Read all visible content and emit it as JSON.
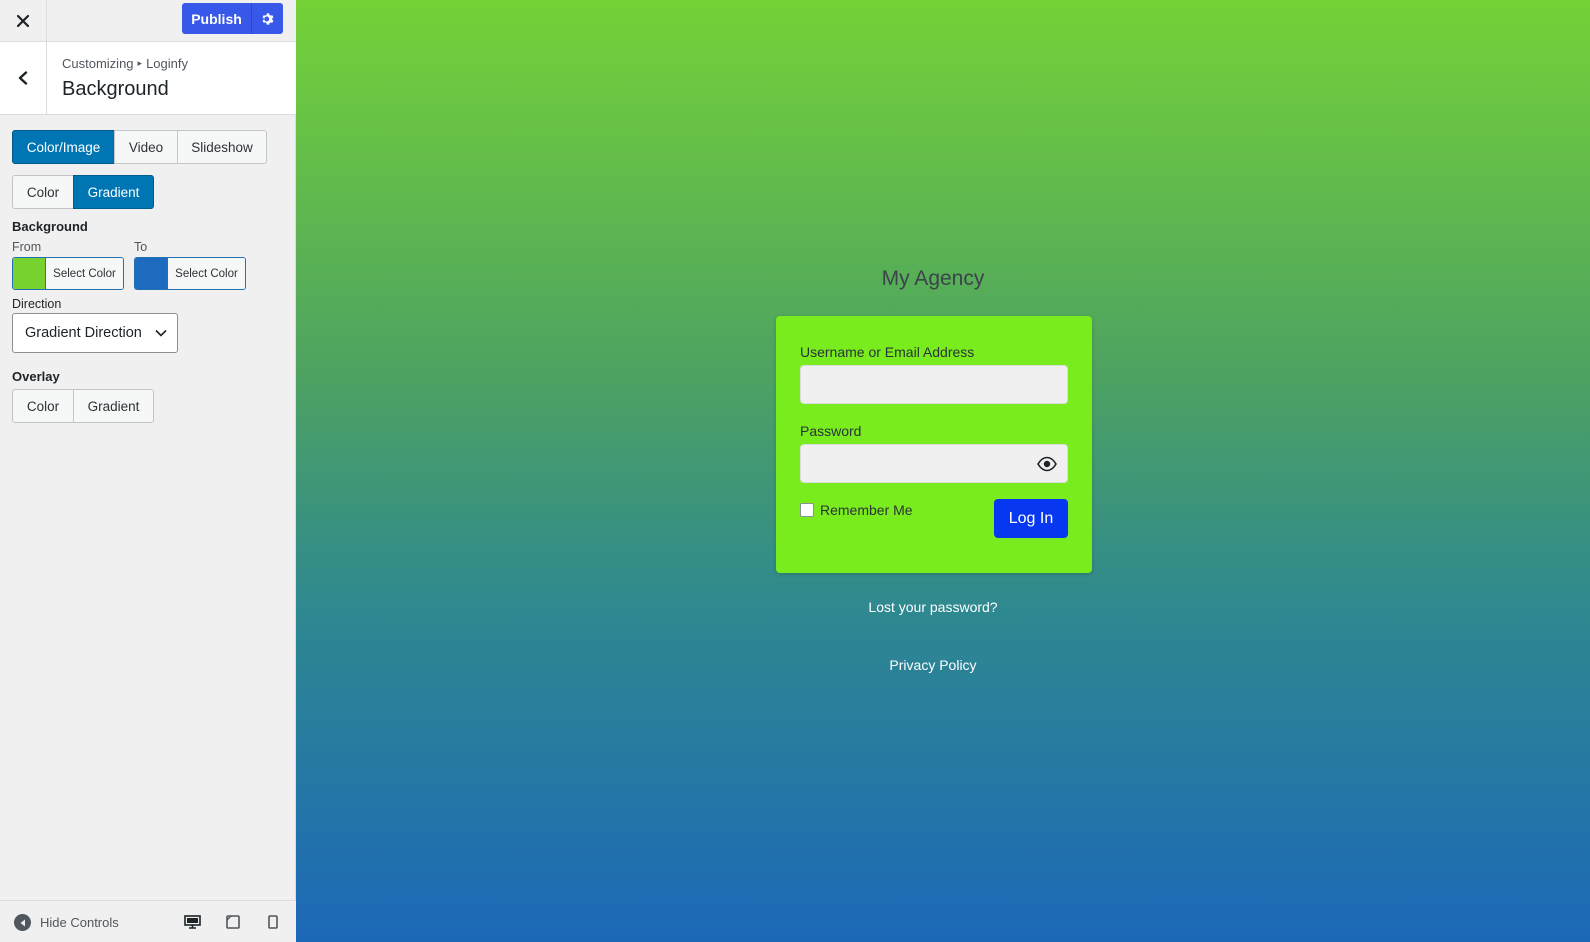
{
  "topbar": {
    "publish_label": "Publish"
  },
  "section": {
    "breadcrumb_parent": "Customizing",
    "breadcrumb_separator": "▸",
    "breadcrumb_child": "Loginfy",
    "title": "Background"
  },
  "bg_type_tabs": [
    {
      "label": "Color/Image",
      "active": true
    },
    {
      "label": "Video",
      "active": false
    },
    {
      "label": "Slideshow",
      "active": false
    }
  ],
  "bg_mode_tabs": [
    {
      "label": "Color",
      "active": false
    },
    {
      "label": "Gradient",
      "active": true
    }
  ],
  "background": {
    "heading": "Background",
    "from_label": "From",
    "to_label": "To",
    "from_color": "#77d22f",
    "to_color": "#1d6bbf",
    "select_color_label": "Select Color"
  },
  "direction": {
    "heading": "Direction",
    "selected": "Gradient Direction"
  },
  "overlay": {
    "heading": "Overlay",
    "tabs": [
      {
        "label": "Color",
        "active": false
      },
      {
        "label": "Gradient",
        "active": false
      }
    ]
  },
  "footer": {
    "hide_controls_label": "Hide Controls"
  },
  "preview": {
    "site_title": "My Agency",
    "username_label": "Username or Email Address",
    "password_label": "Password",
    "remember_label": "Remember Me",
    "login_button": "Log In",
    "lost_password": "Lost your password?",
    "privacy_policy": "Privacy Policy"
  },
  "colors": {
    "publish": "#3858e9",
    "active_tab": "#0075b4",
    "login_box": "#78ec1d",
    "login_button": "#0737f0",
    "gradient_from": "#77d22f",
    "gradient_to": "#1d6bbf"
  }
}
